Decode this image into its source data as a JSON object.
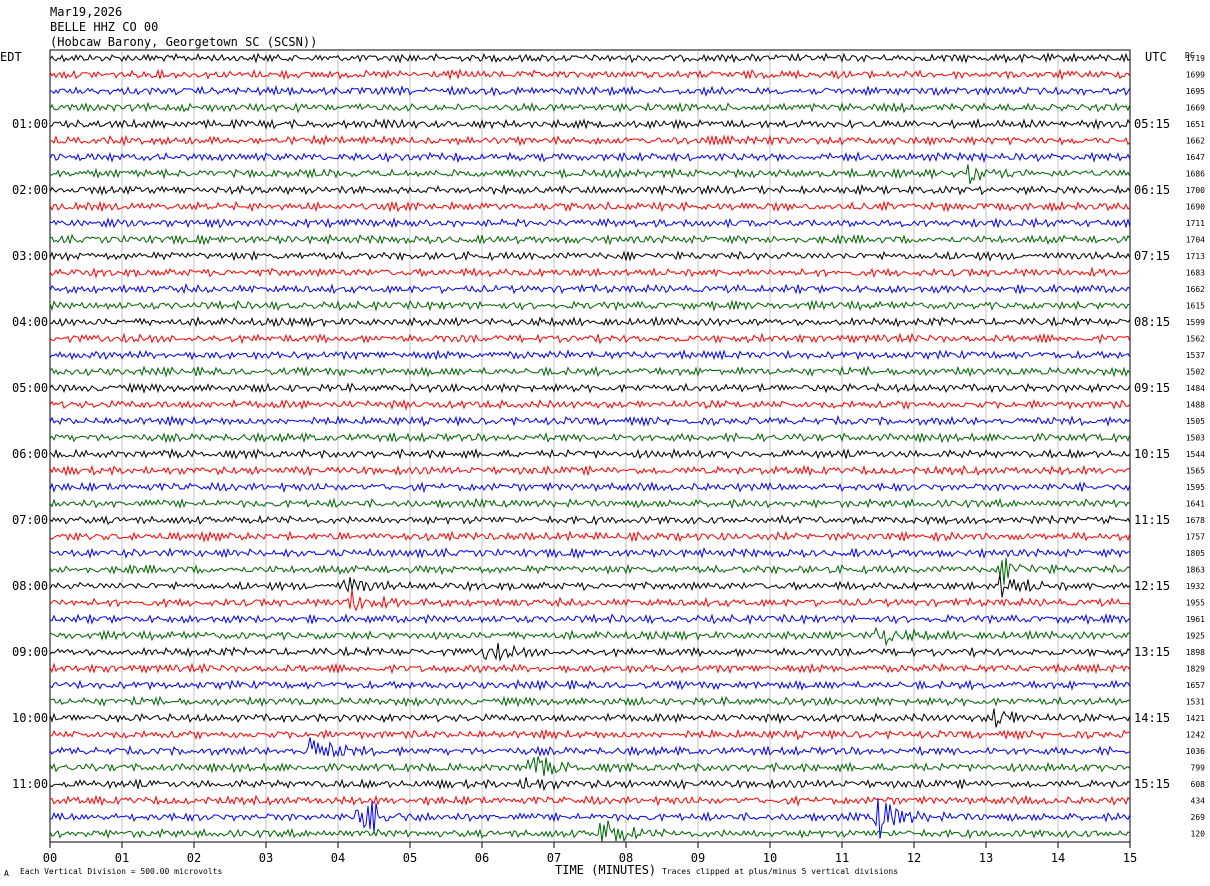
{
  "header": {
    "date": "Mar19,2026",
    "station": "BELLE HHZ CO 00",
    "location": "(Hobcaw Barony, Georgetown SC (SCSN))"
  },
  "left_zone_label": "EDT",
  "right_zone_label": "UTC",
  "dc_label": "DC",
  "footer": {
    "left_note": "Each Vertical Division =  500.00 microvolts",
    "axis_title": "TIME (MINUTES)",
    "right_note": "Traces clipped at plus/minus 5 vertical divisions",
    "corner_mark": "A"
  },
  "chart_data": {
    "type": "line",
    "title": "",
    "xlabel": "TIME (MINUTES)",
    "ylabel": "",
    "xlim": [
      0,
      15
    ],
    "x_ticks": [
      "00",
      "01",
      "02",
      "03",
      "04",
      "05",
      "06",
      "07",
      "08",
      "09",
      "10",
      "11",
      "12",
      "13",
      "14",
      "15"
    ],
    "grid": true,
    "trace_colors": [
      "#000000",
      "#ff0000",
      "#0000ff",
      "#006400"
    ],
    "left_time_labels": [
      "01:00",
      "02:00",
      "03:00",
      "04:00",
      "05:00",
      "06:00",
      "07:00",
      "08:00",
      "09:00",
      "10:00",
      "11:00"
    ],
    "right_time_labels": [
      "05:15",
      "06:15",
      "07:15",
      "08:15",
      "09:15",
      "10:15",
      "11:15",
      "12:15",
      "13:15",
      "14:15",
      "15:15"
    ],
    "dc_offsets": [
      1719,
      1699,
      1695,
      1669,
      1651,
      1662,
      1647,
      1686,
      1700,
      1690,
      1711,
      1704,
      1713,
      1683,
      1662,
      1615,
      1599,
      1562,
      1537,
      1502,
      1484,
      1488,
      1505,
      1503,
      1544,
      1565,
      1595,
      1641,
      1678,
      1757,
      1805,
      1863,
      1932,
      1955,
      1961,
      1925,
      1898,
      1829,
      1657,
      1531,
      1421,
      1242,
      1036,
      799,
      608,
      434,
      269,
      120
    ],
    "events": [
      {
        "row": 7,
        "minute": 12.75,
        "amp": 2.0
      },
      {
        "row": 31,
        "minute": 13.25,
        "amp": 3.0
      },
      {
        "row": 32,
        "minute": 4.1,
        "amp": 2.3
      },
      {
        "row": 32,
        "minute": 13.2,
        "amp": 3.5
      },
      {
        "row": 33,
        "minute": 4.15,
        "amp": 3.0
      },
      {
        "row": 35,
        "minute": 11.45,
        "amp": 3.0
      },
      {
        "row": 36,
        "minute": 6.05,
        "amp": 2.4
      },
      {
        "row": 40,
        "minute": 13.1,
        "amp": 2.8
      },
      {
        "row": 42,
        "minute": 3.6,
        "amp": 4.5
      },
      {
        "row": 43,
        "minute": 6.65,
        "amp": 3.5
      },
      {
        "row": 44,
        "minute": 6.6,
        "amp": 1.8
      },
      {
        "row": 46,
        "minute": 4.3,
        "amp": 6.0
      },
      {
        "row": 46,
        "minute": 11.5,
        "amp": 6.0
      },
      {
        "row": 47,
        "minute": 7.65,
        "amp": 4.5
      }
    ]
  }
}
